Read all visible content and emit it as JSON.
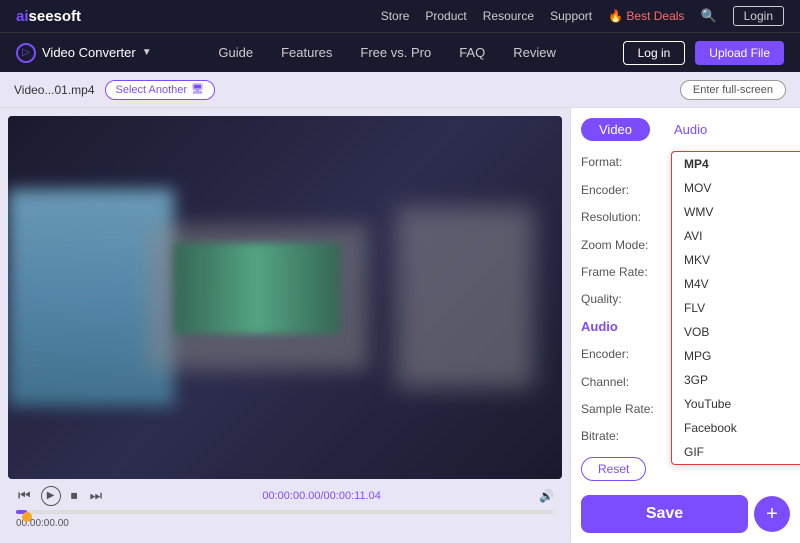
{
  "topNav": {
    "logo": "aiseesoft",
    "links": [
      "Store",
      "Product",
      "Resource",
      "Support",
      "Best Deals"
    ],
    "loginLabel": "Login"
  },
  "secondNav": {
    "appTitle": "Video Converter",
    "links": [
      "Guide",
      "Features",
      "Free vs. Pro",
      "FAQ",
      "Review"
    ],
    "loginLabel": "Log in",
    "uploadLabel": "Upload File"
  },
  "fileBar": {
    "fileName": "Video...01.mp4",
    "selectAnotherLabel": "Select Another",
    "fullscreenLabel": "Enter full-screen"
  },
  "tabs": {
    "videoLabel": "Video",
    "audioLabel": "Audio"
  },
  "settings": {
    "formatLabel": "Format:",
    "encoderLabel": "Encoder:",
    "resolutionLabel": "Resolution:",
    "zoomModeLabel": "Zoom Mode:",
    "frameRateLabel": "Frame Rate:",
    "qualityLabel": "Quality:",
    "audioLabel": "Audio",
    "audioEncoderLabel": "Encoder:",
    "channelLabel": "Channel:",
    "sampleRateLabel": "Sample Rate:",
    "bitrateLabel": "Bitrate:",
    "selectedFormat": "MP4",
    "resetLabel": "Reset",
    "saveLabel": "Save"
  },
  "formatDropdown": {
    "options": [
      "MP4",
      "MOV",
      "WMV",
      "AVI",
      "MKV",
      "M4V",
      "FLV",
      "VOB",
      "MPG",
      "3GP",
      "YouTube",
      "Facebook",
      "GIF"
    ]
  },
  "player": {
    "currentTime": "00:00:00.00",
    "timeDisplay": "00:00:00.00/00:00:11.04"
  }
}
